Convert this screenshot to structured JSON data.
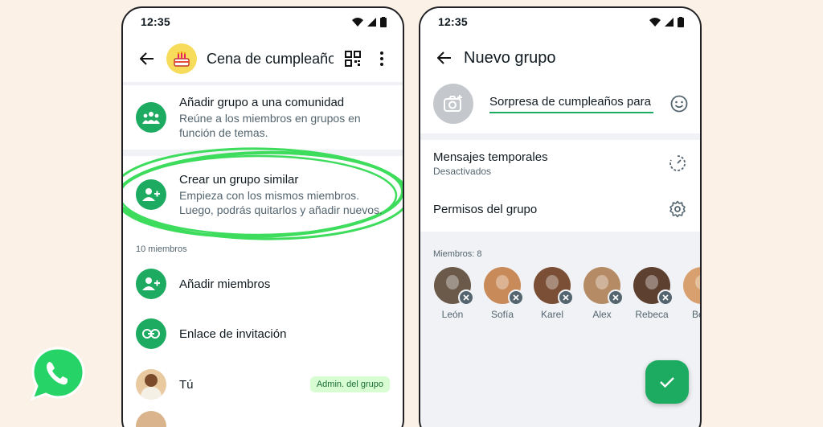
{
  "colors": {
    "accent": "#1daa61",
    "background": "#fbf1e6",
    "badge_bg": "#d9fdd3",
    "highlight_ring": "#3ddc5c"
  },
  "left_screen": {
    "status_time": "12:35",
    "header": {
      "group_name": "Cena de cumpleaños",
      "avatar_icon": "birthday-cake-icon"
    },
    "community_row": {
      "title": "Añadir grupo a una comunidad",
      "subtitle_line1": "Reúne a los miembros en grupos en",
      "subtitle_line2": "función de temas."
    },
    "similar_group_row": {
      "title": "Crear un grupo similar",
      "subtitle_line1": "Empieza con los mismos miembros.",
      "subtitle_line2": "Luego, podrás quitarlos y añadir nuevos."
    },
    "members_count_label": "10 miembros",
    "add_members_label": "Añadir miembros",
    "invite_link_label": "Enlace de invitación",
    "self_member": {
      "name": "Tú",
      "badge": "Admin. del grupo"
    }
  },
  "right_screen": {
    "status_time": "12:35",
    "header": {
      "title": "Nuevo grupo"
    },
    "group_name_value": "Sorpresa de cumpleaños para",
    "disappearing": {
      "title": "Mensajes temporales",
      "subtitle": "Desactivados"
    },
    "permissions_label": "Permisos del grupo",
    "members_label": "Miembros: 8",
    "members": [
      {
        "name": "León",
        "color": "#6b5a4a"
      },
      {
        "name": "Sofía",
        "color": "#c98a5a"
      },
      {
        "name": "Karel",
        "color": "#7a4f35"
      },
      {
        "name": "Alex",
        "color": "#b58b66"
      },
      {
        "name": "Rebeca",
        "color": "#5e4030"
      },
      {
        "name": "Beni",
        "color": "#d8a06e"
      }
    ]
  }
}
